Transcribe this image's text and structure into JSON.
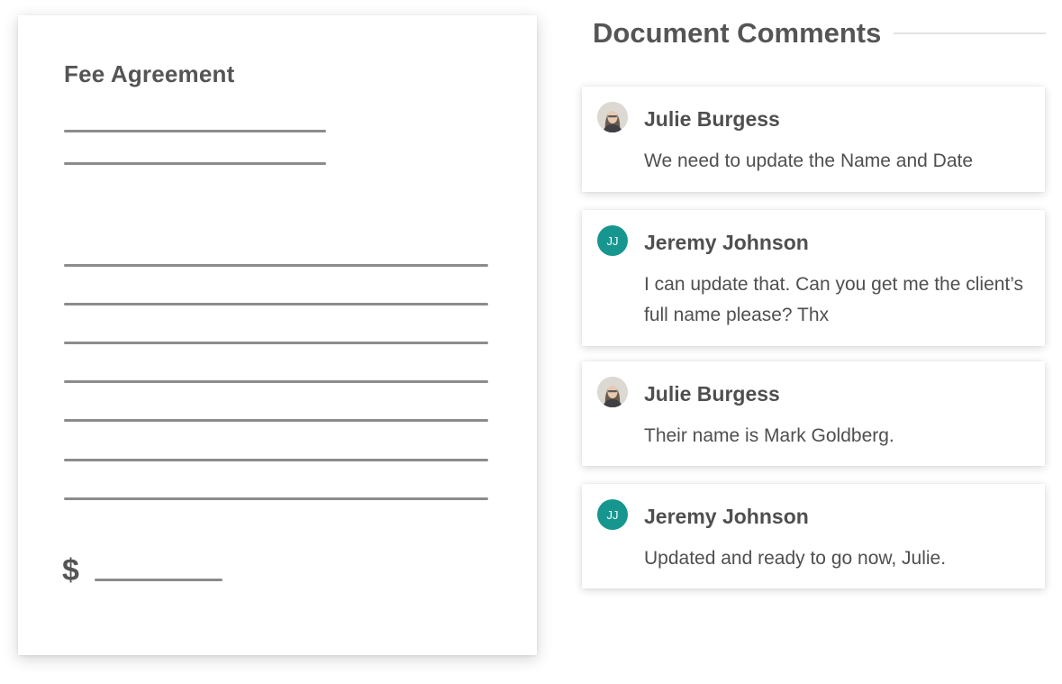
{
  "document": {
    "title": "Fee Agreement",
    "currency_symbol": "$"
  },
  "comments_panel": {
    "title": "Document Comments",
    "comments": [
      {
        "author": "Julie Burgess",
        "avatar": "user-photo",
        "message": "We need to update the Name and Date"
      },
      {
        "author": "Jeremy Johnson",
        "avatar_initials": "JJ",
        "avatar_color": "#16968f",
        "message": "I can update that. Can you get me the client’s full name please? Thx"
      },
      {
        "author": "Julie Burgess",
        "avatar": "user-photo",
        "message": "Their name is Mark Goldberg."
      },
      {
        "author": "Jeremy Johnson",
        "avatar_initials": "JJ",
        "avatar_color": "#16968f",
        "message": "Updated and ready to go now, Julie."
      }
    ]
  }
}
